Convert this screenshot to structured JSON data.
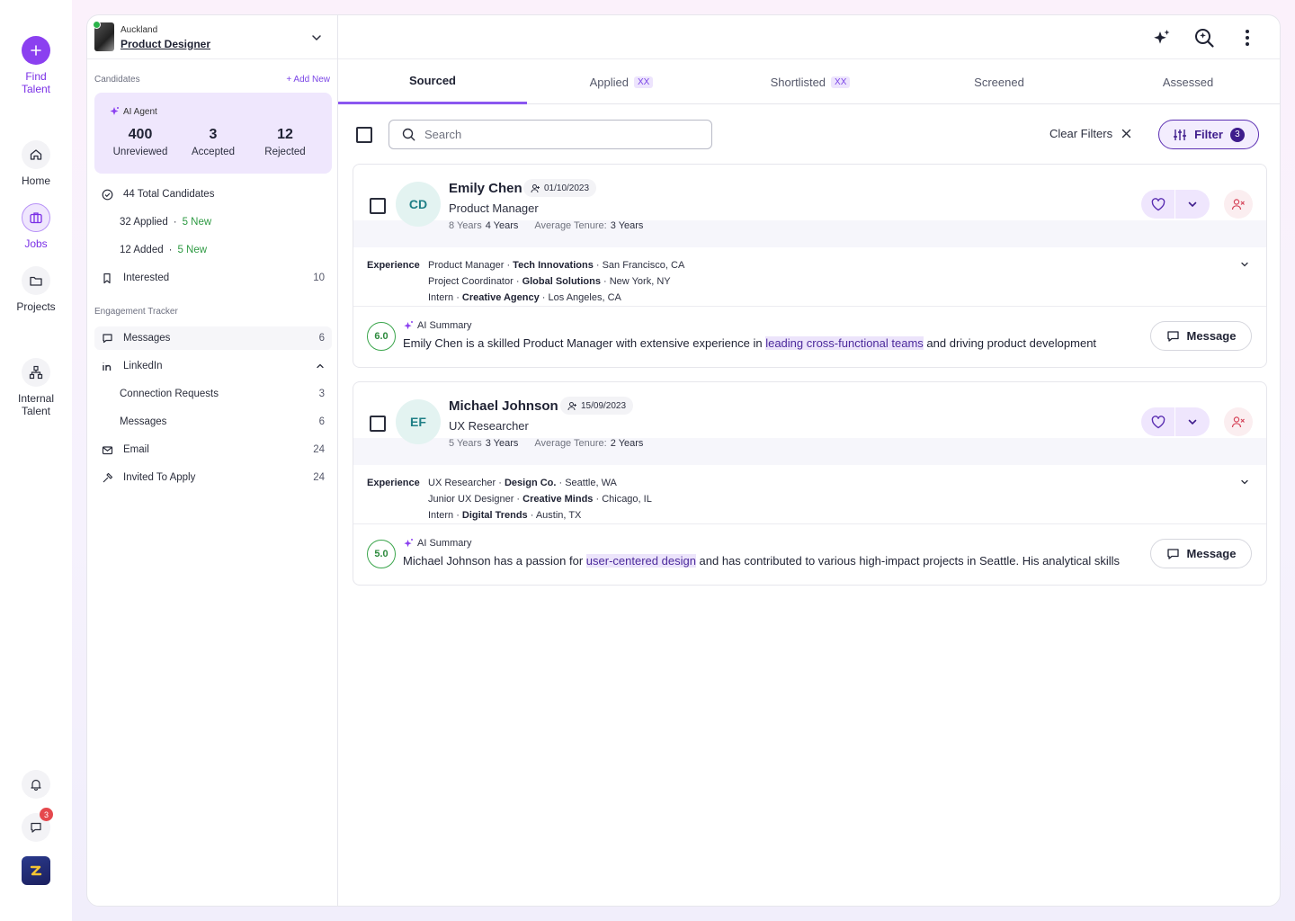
{
  "rail": {
    "find_talent": "Find Talent",
    "home": "Home",
    "jobs": "Jobs",
    "projects": "Projects",
    "internal_talent": "Internal Talent",
    "messages_badge": "3"
  },
  "job": {
    "location": "Auckland",
    "title": "Product Designer"
  },
  "sidebar": {
    "candidates_label": "Candidates",
    "add_new": "+ Add New",
    "agent_label": "AI Agent",
    "stats": [
      {
        "value": "400",
        "label": "Unreviewed"
      },
      {
        "value": "3",
        "label": "Accepted"
      },
      {
        "value": "12",
        "label": "Rejected"
      }
    ],
    "total_candidates": "44 Total Candidates",
    "applied": "32 Applied",
    "applied_new": "5 New",
    "added": "12 Added",
    "added_new": "5 New",
    "interested": {
      "label": "Interested",
      "count": "10"
    },
    "engagement_label": "Engagement Tracker",
    "messages": {
      "label": "Messages",
      "count": "6"
    },
    "linkedin": {
      "label": "LinkedIn"
    },
    "connection_requests": {
      "label": "Connection Requests",
      "count": "3"
    },
    "linkedin_messages": {
      "label": "Messages",
      "count": "6"
    },
    "email": {
      "label": "Email",
      "count": "24"
    },
    "invited": {
      "label": "Invited To Apply",
      "count": "24"
    }
  },
  "tabs": [
    {
      "label": "Sourced",
      "badge": ""
    },
    {
      "label": "Applied",
      "badge": "XX"
    },
    {
      "label": "Shortlisted",
      "badge": "XX"
    },
    {
      "label": "Screened",
      "badge": ""
    },
    {
      "label": "Assessed",
      "badge": ""
    }
  ],
  "toolbar": {
    "search_placeholder": "Search",
    "clear_filters": "Clear Filters",
    "filter_label": "Filter",
    "filter_count": "3"
  },
  "candidates": [
    {
      "initials": "CD",
      "name": "Emily Chen",
      "date": "01/10/2023",
      "role": "Product Manager",
      "years": "8 Years",
      "role_years": "4 Years",
      "tenure_label": "Average Tenure:",
      "tenure": "3 Years",
      "experience_label": "Experience",
      "experience": [
        {
          "title": "Product Manager",
          "company": "Tech Innovations",
          "location": "San Francisco, CA"
        },
        {
          "title": "Project Coordinator",
          "company": "Global Solutions",
          "location": "New York, NY"
        },
        {
          "title": "Intern",
          "company": "Creative Agency",
          "location": "Los Angeles, CA"
        }
      ],
      "score": "6.0",
      "ai_label": "AI Summary",
      "summary_pre": "Emily Chen is a skilled Product Manager with extensive experience in ",
      "summary_highlight": "leading cross-functional teams",
      "summary_post": " and driving product development",
      "message": "Message"
    },
    {
      "initials": "EF",
      "name": "Michael Johnson",
      "date": "15/09/2023",
      "role": "UX Researcher",
      "years": "5 Years",
      "role_years": "3 Years",
      "tenure_label": "Average Tenure:",
      "tenure": "2 Years",
      "experience_label": "Experience",
      "experience": [
        {
          "title": "UX Researcher",
          "company": "Design Co.",
          "location": "Seattle, WA"
        },
        {
          "title": "Junior UX Designer",
          "company": "Creative Minds",
          "location": "Chicago, IL"
        },
        {
          "title": "Intern",
          "company": "Digital Trends",
          "location": "Austin, TX"
        }
      ],
      "score": "5.0",
      "ai_label": "AI Summary",
      "summary_pre": "Michael Johnson has a passion for ",
      "summary_highlight": "user-centered design",
      "summary_post": " and has contributed to various high-impact projects in Seattle. His analytical skills",
      "message": "Message"
    }
  ],
  "colors": {
    "accent": "#8b40f0",
    "accent_dark": "#3f1d8c",
    "green": "#2e9a43",
    "danger": "#e5484d"
  }
}
